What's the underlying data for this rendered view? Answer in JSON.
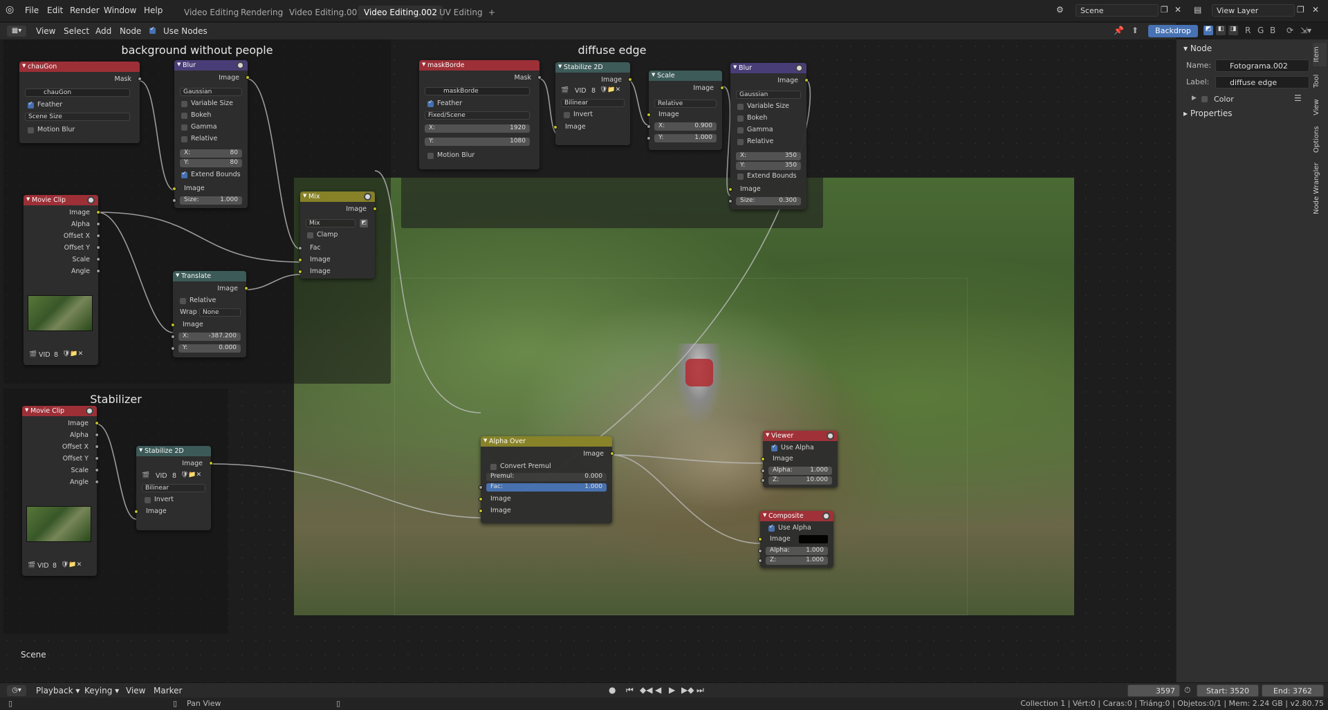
{
  "menus": [
    "File",
    "Edit",
    "Render",
    "Window",
    "Help"
  ],
  "workspaces": [
    "Video Editing",
    "Rendering",
    "Video Editing.001",
    "Video Editing.002",
    "UV Editing"
  ],
  "active_workspace": "Video Editing.002",
  "add_workspace": "+",
  "scene_name": "Scene",
  "view_layer": "View Layer",
  "editor_menu": [
    "View",
    "Select",
    "Add",
    "Node"
  ],
  "use_nodes_label": "Use Nodes",
  "backdrop_label": "Backdrop",
  "backdrop_channels": [
    "R",
    "G",
    "B"
  ],
  "frames": {
    "bg": "background without people",
    "diffuse": "diffuse edge",
    "stab": "Stabilizer"
  },
  "nodes": {
    "chaugon": {
      "title": "chauGon",
      "out_mask": "Mask",
      "mask_name": "chauGon",
      "feather": "Feather",
      "size_mode": "Scene Size",
      "motion_blur": "Motion Blur"
    },
    "blur1": {
      "title": "Blur",
      "out": "Image",
      "filter": "Gaussian",
      "opts": [
        "Variable Size",
        "Bokeh",
        "Gamma",
        "Relative"
      ],
      "x_l": "X:",
      "x_v": "80",
      "y_l": "Y:",
      "y_v": "80",
      "extend": "Extend Bounds",
      "in_image": "Image",
      "size_l": "Size:",
      "size_v": "1.000"
    },
    "movieclip1": {
      "title": "Movie Clip",
      "outs": [
        "Image",
        "Alpha",
        "Offset X",
        "Offset Y",
        "Scale",
        "Angle"
      ],
      "clip": "VID",
      "users": "8"
    },
    "translate": {
      "title": "Translate",
      "out": "Image",
      "relative": "Relative",
      "wrap_l": "Wrap",
      "wrap_v": "None",
      "in_image": "Image",
      "x_l": "X:",
      "x_v": "-387.200",
      "y_l": "Y:",
      "y_v": "0.000"
    },
    "mix": {
      "title": "Mix",
      "out": "Image",
      "mode": "Mix",
      "clamp": "Clamp",
      "ins": [
        "Fac",
        "Image",
        "Image"
      ]
    },
    "maskborde": {
      "title": "maskBorde",
      "out_mask": "Mask",
      "mask_name": "maskBorde",
      "feather": "Feather",
      "size_mode": "Fixed/Scene",
      "x_l": "X:",
      "x_v": "1920",
      "y_l": "Y:",
      "y_v": "1080",
      "motion_blur": "Motion Blur"
    },
    "stab1": {
      "title": "Stabilize 2D",
      "out": "Image",
      "clip": "VID",
      "users": "8",
      "filter": "Bilinear",
      "invert": "Invert",
      "in_image": "Image"
    },
    "scale": {
      "title": "Scale",
      "out": "Image",
      "mode": "Relative",
      "in_image": "Image",
      "x_l": "X:",
      "x_v": "0.900",
      "y_l": "Y:",
      "y_v": "1.000"
    },
    "blur2": {
      "title": "Blur",
      "out": "Image",
      "filter": "Gaussian",
      "opts": [
        "Variable Size",
        "Bokeh",
        "Gamma",
        "Relative"
      ],
      "x_l": "X:",
      "x_v": "350",
      "y_l": "Y:",
      "y_v": "350",
      "extend": "Extend Bounds",
      "in_image": "Image",
      "size_l": "Size:",
      "size_v": "0.300"
    },
    "movieclip2": {
      "title": "Movie Clip",
      "outs": [
        "Image",
        "Alpha",
        "Offset X",
        "Offset Y",
        "Scale",
        "Angle"
      ],
      "clip": "VID",
      "users": "8"
    },
    "stab2": {
      "title": "Stabilize 2D",
      "out": "Image",
      "clip": "VID",
      "users": "8",
      "filter": "Bilinear",
      "invert": "Invert",
      "in_image": "Image"
    },
    "alphaover": {
      "title": "Alpha Over",
      "out": "Image",
      "convert": "Convert Premul",
      "premul_l": "Premul:",
      "premul_v": "0.000",
      "fac_l": "Fac:",
      "fac_v": "1.000",
      "ins": [
        "Image",
        "Image"
      ]
    },
    "viewer": {
      "title": "Viewer",
      "use_alpha": "Use Alpha",
      "in_image": "Image",
      "alpha_l": "Alpha:",
      "alpha_v": "1.000",
      "z_l": "Z:",
      "z_v": "10.000"
    },
    "composite": {
      "title": "Composite",
      "use_alpha": "Use Alpha",
      "in_image": "Image",
      "alpha_l": "Alpha:",
      "alpha_v": "1.000",
      "z_l": "Z:",
      "z_v": "1.000"
    }
  },
  "scene_label": "Scene",
  "sidebar": {
    "section": "Node",
    "name_l": "Name:",
    "name_v": "Fotograma.002",
    "label_l": "Label:",
    "label_v": "diffuse edge",
    "color": "Color",
    "properties": "Properties",
    "tabs": [
      "Item",
      "Tool",
      "View",
      "Options",
      "Node Wrangler"
    ]
  },
  "timeline": {
    "menus": [
      "Playback",
      "Keying",
      "View",
      "Marker"
    ],
    "current": "3597",
    "start": "Start: 3520",
    "end": "End: 3762"
  },
  "status": {
    "hint": "Pan View",
    "info": "Collection 1 | Vért:0 | Caras:0 | Triáng:0 | Objetos:0/1 | Mem: 2.24 GB | v2.80.75"
  }
}
